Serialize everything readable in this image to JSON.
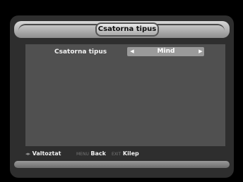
{
  "header": {
    "title": "Csatorna tipus"
  },
  "setting": {
    "label": "Csatorna tipus",
    "value": "Mind",
    "left_arrow_icon": "arrow-left-icon",
    "right_arrow_icon": "arrow-right-icon"
  },
  "footer": {
    "change_key": "◂▸",
    "change_label": "Valtoztat",
    "menu_key": "MENU",
    "menu_label": "Back",
    "exit_key": "EXIT",
    "exit_label": "Kilep"
  },
  "colors": {
    "background": "#000000",
    "panel": "#2e2e2e",
    "content": "#505050",
    "selector": "#9a9a9a",
    "text": "#f2f2f2"
  }
}
